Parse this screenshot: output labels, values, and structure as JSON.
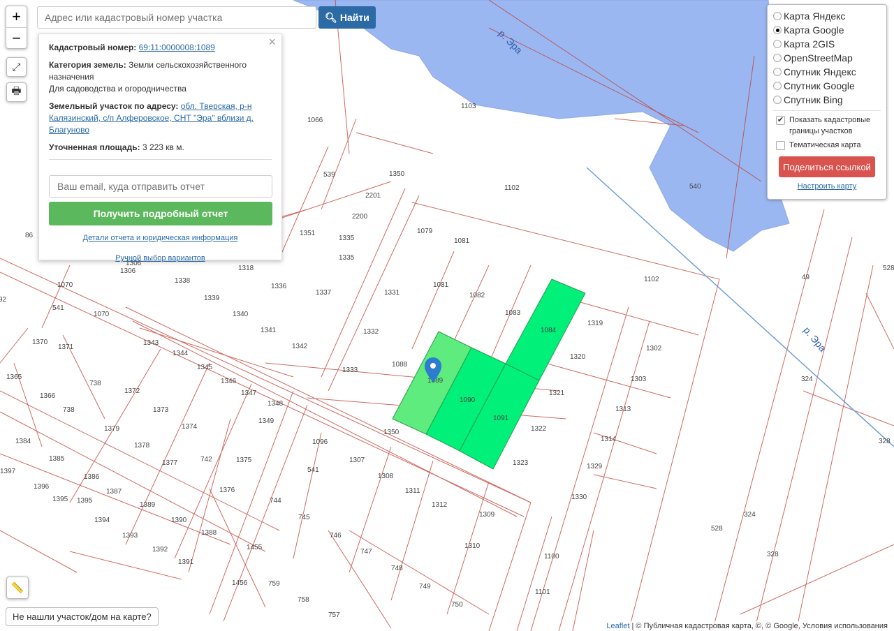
{
  "search": {
    "placeholder": "Адрес или кадастровый номер участка",
    "button": "Найти"
  },
  "zoom": {
    "in": "+",
    "out": "−"
  },
  "popup": {
    "cad_label": "Кадастровый номер:",
    "cad_value": "69:11:0000008:1089",
    "cat_label": "Категория земель:",
    "cat_value": "Земли сельскохозяйственного назначения",
    "use": "Для садоводства и огородничества",
    "addr_label": "Земельный участок по адресу:",
    "addr_value": "обл. Тверская, р-н Калязинский, с/п Алферовское, СНТ \"Эра\" вблизи д. Благуново",
    "area_label": "Уточненная площадь:",
    "area_value": "3 223 кв м.",
    "email_placeholder": "Ваш email, куда отправить отчет",
    "report_button": "Получить подробный отчет",
    "details_link": "Детали отчета и юридическая информация",
    "manual_link": "Ручной выбор вариантов"
  },
  "layers": {
    "options": [
      {
        "label": "Карта Яндекс",
        "selected": false
      },
      {
        "label": "Карта Google",
        "selected": true
      },
      {
        "label": "Карта 2GIS",
        "selected": false
      },
      {
        "label": "OpenStreetMap",
        "selected": false
      },
      {
        "label": "Спутник Яндекс",
        "selected": false
      },
      {
        "label": "Спутник Google",
        "selected": false
      },
      {
        "label": "Спутник Bing",
        "selected": false
      }
    ],
    "show_borders": "Показать кадастровые границы участков",
    "show_borders_checked": true,
    "thematic": "Тематическая карта",
    "thematic_checked": false,
    "share": "Поделиться ссылкой",
    "configure": "Настроить карту"
  },
  "not_found": "Не нашли участок/дом на карте?",
  "attribution": {
    "leaflet": "Leaflet",
    "rest": "| © Публичная кадастровая карта, ©, © Google, Условия использования"
  },
  "map_labels": {
    "river1": "р. Эра",
    "river2": "р. Эра",
    "parcels": [
      "1103",
      "1066",
      "539",
      "1350",
      "2201",
      "2200",
      "1102",
      "540",
      "1351",
      "1335",
      "1335",
      "1079",
      "1081",
      "1081",
      "1082",
      "1083",
      "1084",
      "1102",
      "1306",
      "1318",
      "1338",
      "1336",
      "1337",
      "1331",
      "1319",
      "1332",
      "1088",
      "1089",
      "1090",
      "1091",
      "1320",
      "1321",
      "1322",
      "1323",
      "1333",
      "1342",
      "1341",
      "1340",
      "1339",
      "1343",
      "1344",
      "1345",
      "1346",
      "1347",
      "1348",
      "1349",
      "1370",
      "1371",
      "1365",
      "1366",
      "738",
      "738",
      "1372",
      "1373",
      "1374",
      "1379",
      "1378",
      "1377",
      "742",
      "1375",
      "1384",
      "1385",
      "1386",
      "1387",
      "1397",
      "1396",
      "1395",
      "1395",
      "1394",
      "1389",
      "1390",
      "1393",
      "1392",
      "1391",
      "1388",
      "1376",
      "1096",
      "1350",
      "1307",
      "1308",
      "1311",
      "1312",
      "1309",
      "1310",
      "1302",
      "1303",
      "1313",
      "1314",
      "1329",
      "1330",
      "1100",
      "1101",
      "744",
      "745",
      "746",
      "747",
      "748",
      "749",
      "750",
      "757",
      "758",
      "759",
      "1455",
      "1456",
      "541",
      "49",
      "528",
      "324",
      "324",
      "528",
      "328",
      "328",
      "1070",
      "1070",
      "541",
      "1306",
      "86",
      "92"
    ]
  }
}
